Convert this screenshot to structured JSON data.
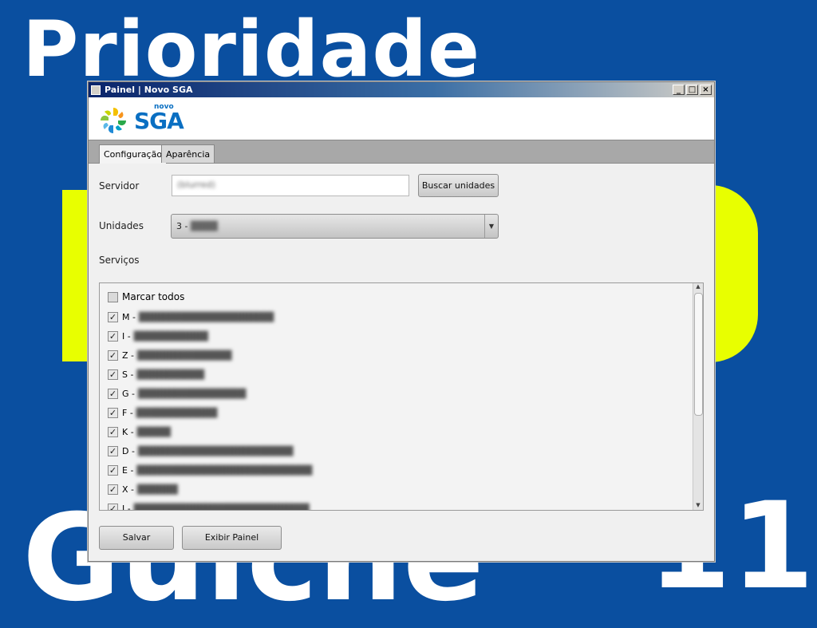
{
  "background": {
    "title": "Prioridade",
    "bottom_text": "Guichê",
    "number": "11"
  },
  "window": {
    "title": "Painel | Novo SGA",
    "controls": [
      "_",
      "□",
      "×"
    ]
  },
  "logo": {
    "novo": "novo",
    "sga": "SGA"
  },
  "tabs": [
    {
      "label": "Configuração",
      "active": true
    },
    {
      "label": "Aparência",
      "active": false
    }
  ],
  "form": {
    "servidor_label": "Servidor",
    "servidor_value": "(blurred)",
    "buscar_button": "Buscar unidades",
    "unidades_label": "Unidades",
    "unidades_value": "3 -",
    "servicos_label": "Serviços"
  },
  "servicos": {
    "marcar_todos": "Marcar todos",
    "items": [
      {
        "code": "M -",
        "checked": true
      },
      {
        "code": "I -",
        "checked": true
      },
      {
        "code": "Z -",
        "checked": true
      },
      {
        "code": "S -",
        "checked": true
      },
      {
        "code": "G -",
        "checked": true
      },
      {
        "code": "F -",
        "checked": true
      },
      {
        "code": "K -",
        "checked": true
      },
      {
        "code": "D -",
        "checked": true
      },
      {
        "code": "E -",
        "checked": true
      },
      {
        "code": "X -",
        "checked": true
      },
      {
        "code": "J -",
        "checked": true
      }
    ]
  },
  "actions": {
    "salvar": "Salvar",
    "exibir": "Exibir Painel"
  },
  "colors": {
    "background": "#0a4fa0",
    "accent_yellow": "#e8ff00",
    "logo_blue": "#0a6fc2"
  }
}
